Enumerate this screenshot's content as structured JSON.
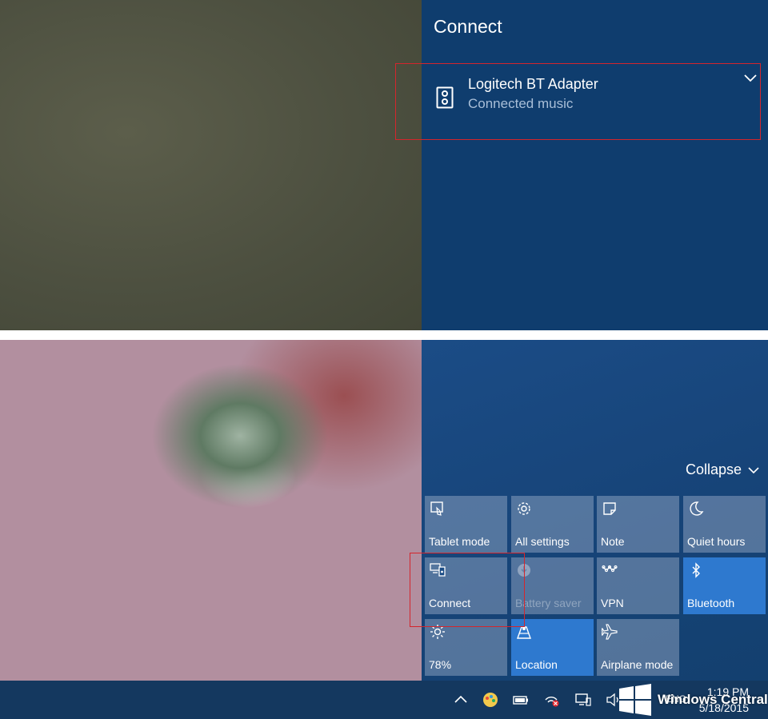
{
  "top_screenshot": {
    "title": "Connect",
    "device": {
      "name": "Logitech BT Adapter",
      "status": "Connected music",
      "icon": "speaker-icon"
    }
  },
  "bottom_screenshot": {
    "collapse_label": "Collapse",
    "tiles": [
      {
        "label": "Tablet mode",
        "icon": "tablet-mode-icon",
        "state": "off"
      },
      {
        "label": "All settings",
        "icon": "gear-icon",
        "state": "off"
      },
      {
        "label": "Note",
        "icon": "note-icon",
        "state": "off"
      },
      {
        "label": "Quiet hours",
        "icon": "moon-icon",
        "state": "off"
      },
      {
        "label": "Connect",
        "icon": "connect-icon",
        "state": "off"
      },
      {
        "label": "Battery saver",
        "icon": "battery-saver-icon",
        "state": "disabled"
      },
      {
        "label": "VPN",
        "icon": "vpn-icon",
        "state": "off"
      },
      {
        "label": "Bluetooth",
        "icon": "bluetooth-icon",
        "state": "on"
      },
      {
        "label": "78%",
        "icon": "brightness-icon",
        "state": "off"
      },
      {
        "label": "Location",
        "icon": "location-icon",
        "state": "on"
      },
      {
        "label": "Airplane mode",
        "icon": "airplane-icon",
        "state": "off"
      }
    ],
    "taskbar": {
      "language": "ENG",
      "time": "1:19 PM",
      "date": "5/18/2015",
      "tray_icons": [
        "chevron-up-icon",
        "paint-icon",
        "battery-icon",
        "network-error-icon",
        "display-icon",
        "volume-icon"
      ]
    },
    "watermark": "Windows Central"
  },
  "colors": {
    "panel_blue": "#0f3d6e",
    "tile_active": "#2e79cf",
    "highlight_red": "#d4252c",
    "taskbar": "#14385f"
  }
}
